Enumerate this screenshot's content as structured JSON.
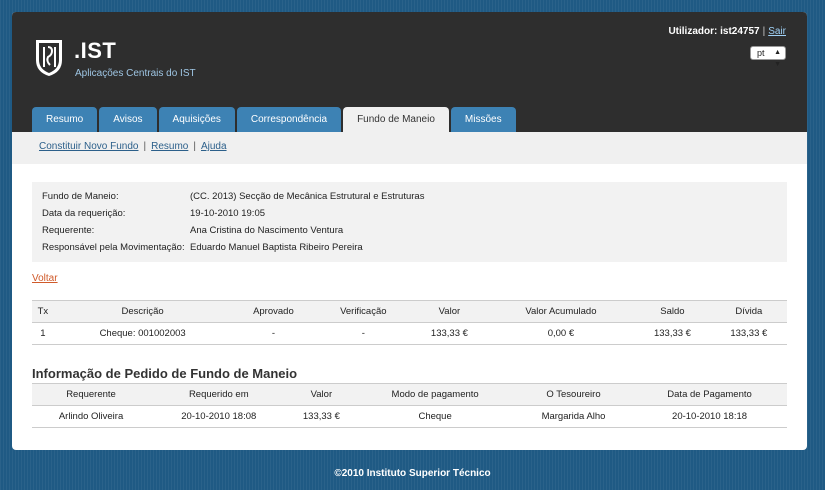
{
  "header": {
    "brand": ".IST",
    "subtitle": "Aplicações Centrais do IST",
    "user_label": "Utilizador: ist24757",
    "separator": "|",
    "logout": "Sair",
    "language": "pt"
  },
  "tabs": [
    {
      "label": "Resumo",
      "active": false
    },
    {
      "label": "Avisos",
      "active": false
    },
    {
      "label": "Aquisições",
      "active": false
    },
    {
      "label": "Correspondência",
      "active": false
    },
    {
      "label": "Fundo de Maneio",
      "active": true
    },
    {
      "label": "Missões",
      "active": false
    }
  ],
  "subnav": {
    "items": [
      "Constituir Novo Fundo",
      "Resumo",
      "Ajuda"
    ],
    "separator": "|"
  },
  "info": [
    {
      "label": "Fundo de Maneio:",
      "value": "(CC. 2013) Secção de Mecânica Estrutural e Estruturas"
    },
    {
      "label": "Data da requerição:",
      "value": "19-10-2010 19:05"
    },
    {
      "label": "Requerente:",
      "value": "Ana Cristina do Nascimento Ventura"
    },
    {
      "label": "Responsável pela Movimentação:",
      "value": "Eduardo Manuel Baptista Ribeiro Pereira"
    }
  ],
  "back_link": "Voltar",
  "movements": {
    "headers": [
      "Tx",
      "Descrição",
      "Aprovado",
      "Verificação",
      "Valor",
      "Valor Acumulado",
      "Saldo",
      "Dívida"
    ],
    "rows": [
      [
        "1",
        "Cheque: 001002003",
        "-",
        "-",
        "133,33 €",
        "0,00 €",
        "133,33 €",
        "133,33 €"
      ]
    ]
  },
  "request_section": {
    "title": "Informação de Pedido de Fundo de Maneio",
    "headers": [
      "Requerente",
      "Requerido em",
      "Valor",
      "Modo de pagamento",
      "O Tesoureiro",
      "Data de Pagamento"
    ],
    "rows": [
      [
        "Arlindo Oliveira",
        "20-10-2010 18:08",
        "133,33 €",
        "Cheque",
        "Margarida Alho",
        "20-10-2010 18:18"
      ]
    ]
  },
  "footer": "©2010 Instituto Superior Técnico",
  "colors": {
    "background": "#1f5a84",
    "header": "#2e2e2e",
    "tab": "#3d82b4",
    "link": "#2b5f8a",
    "back_link": "#d05a2a"
  }
}
